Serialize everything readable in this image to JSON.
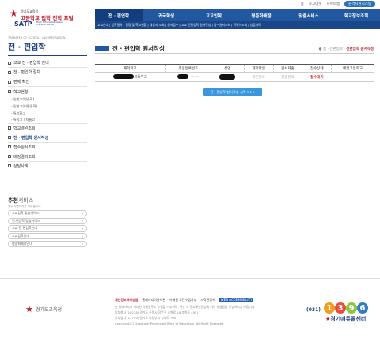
{
  "topbar": {
    "home": "홈",
    "logout": "로그아웃",
    "sitemap": "사이트맵",
    "btn": "원격지원시스템"
  },
  "logo": {
    "org": "경기도교육청",
    "name": "고등학교 입학 전학 포털",
    "satp": "SATP",
    "sub1": "High School Admission",
    "sub2": "Transfer Portal"
  },
  "mainnav": [
    {
      "label": "전 · 편입학"
    },
    {
      "label": "귀국학생"
    },
    {
      "label": "고교입학"
    },
    {
      "label": "평준화배정"
    },
    {
      "label": "맞춤서비스"
    },
    {
      "label": "학교정보조회"
    }
  ],
  "subnav": "고교안내 | 입학절차 | 일정 및 학교현황 | 대상자 조회 | 원서접수 | 고교 전편입학 원서작성 | 접수원서조회 | 학적이조회 | 상담사례",
  "sidebar": {
    "eng": "TRANSFER OF SCHOOL · INCORPORATION",
    "title": "전 · 편입학",
    "items": [
      {
        "label": "고교 전 · 편입학 안내",
        "type": "main"
      },
      {
        "label": "전 · 편입학 절차",
        "type": "main"
      },
      {
        "label": "편제 확인",
        "type": "main"
      },
      {
        "label": "학교현황",
        "type": "main"
      },
      {
        "label": "- 일반고(평준화)",
        "type": "sub"
      },
      {
        "label": "- 일반고(비평준화)",
        "type": "sub"
      },
      {
        "label": "- 특성화고",
        "type": "sub"
      },
      {
        "label": "- 특목고 / 자율고",
        "type": "sub"
      },
      {
        "label": "학교결원조회",
        "type": "main"
      },
      {
        "label": "전 · 편입학 원서작성",
        "type": "active"
      },
      {
        "label": "접수원서조회",
        "type": "main"
      },
      {
        "label": "배정결과조회",
        "type": "main"
      },
      {
        "label": "상담사례",
        "type": "main"
      }
    ]
  },
  "recommend": {
    "title": "추천",
    "title2": "서비스",
    "sub": "자주 사용하시는 메뉴입니다.",
    "items": [
      "고교입학 맞춤가이드",
      "전.편입학 맞춤가이드",
      "고교 전.편입학안내",
      "고교입학안내",
      "평준화배정안내"
    ]
  },
  "content": {
    "title": "전 · 편입학 원서작성",
    "breadcrumb": "● 홈 · 전편입학 ·",
    "breadcrumb_cur": "전편입학 원서작성",
    "headers": [
      "재학학교",
      "주민등록번호",
      "성명",
      "재학확인",
      "원서제출",
      "접수상태",
      "배정고등학교"
    ],
    "row": {
      "school": "고등학교",
      "rrn": "-",
      "confirm": "확인완료",
      "submit": "전송완료",
      "status": "접수대기",
      "assigned": ""
    },
    "start_btn": "전 · 편입학 원서작성 시작 >>>"
  },
  "footer": {
    "org": "경기도교육청",
    "links": [
      "개인정보처리방침",
      "홈페이지이용약관",
      "이메일 무단수집거부",
      "저작권정책"
    ],
    "wa": "WEB ACCESSIBILITY",
    "line1": "본 홈페이지에 게시된 이메일주소 수집을 거부하며, 위반 시 정보통신망법에 의해 처벌됨을 유념하시기 바랍니다.",
    "line2": "남부청사 (16278) 경기도 수원시 장안구 조원로 18(조원동 495)",
    "line3": "북부청사 (11759) 경기도 의정부시 청사로 700",
    "line4": "Copyright(C) Gyeonggi Provincial Office of Education. All Right Reserved",
    "call_prefix": "(031)",
    "digits": [
      "1",
      "3",
      "9",
      "6"
    ],
    "call_tag": "경기애듀콜센터"
  }
}
